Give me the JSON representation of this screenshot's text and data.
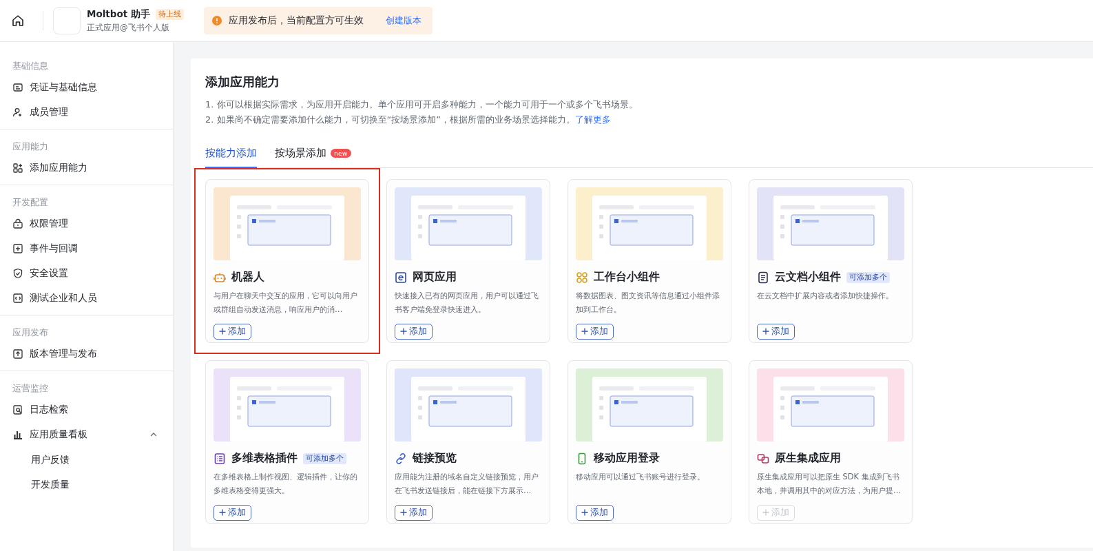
{
  "topbar": {
    "app_name": "Moltbot 助手",
    "status_badge": "待上线",
    "app_subtitle": "正式应用@飞书个人版",
    "notice": {
      "text": "应用发布后，当前配置方可生效",
      "link": "创建版本"
    }
  },
  "sidebar": {
    "sections": [
      {
        "title": "基础信息",
        "items": [
          {
            "label": "凭证与基础信息"
          },
          {
            "label": "成员管理"
          }
        ]
      },
      {
        "title": "应用能力",
        "items": [
          {
            "label": "添加应用能力"
          }
        ]
      },
      {
        "title": "开发配置",
        "items": [
          {
            "label": "权限管理"
          },
          {
            "label": "事件与回调"
          },
          {
            "label": "安全设置"
          },
          {
            "label": "测试企业和人员"
          }
        ]
      },
      {
        "title": "应用发布",
        "items": [
          {
            "label": "版本管理与发布"
          }
        ]
      },
      {
        "title": "运营监控",
        "items": [
          {
            "label": "日志检索"
          },
          {
            "label": "应用质量看板",
            "expanded": true,
            "children": [
              {
                "label": "用户反馈"
              },
              {
                "label": "开发质量"
              }
            ]
          }
        ]
      }
    ]
  },
  "main": {
    "title": "添加应用能力",
    "notes": [
      "1. 你可以根据实际需求，为应用开启能力。单个应用可开启多种能力，一个能力可用于一个或多个飞书场景。",
      "2. 如果尚不确定需要添加什么能力，可切换至“按场景添加”，根据所需的业务场景选择能力。"
    ],
    "learn_more": "了解更多",
    "tabs": [
      {
        "label": "按能力添加",
        "selected": true
      },
      {
        "label": "按场景添加",
        "selected": false,
        "badge": "new"
      }
    ],
    "cards": [
      {
        "kind": "robot",
        "title": "机器人",
        "description": "与用户在聊天中交互的应用，它可以向用户或群组自动发送消息，响应用户的消…",
        "button": "添加",
        "disabled": false,
        "highlighted": true,
        "color": "#fbe6cf"
      },
      {
        "kind": "web",
        "title": "网页应用",
        "description": "快速接入已有的网页应用，用户可以通过飞书客户端免登录快速进入。",
        "button": "添加",
        "disabled": false,
        "highlighted": false,
        "color": "#e1e7fb"
      },
      {
        "kind": "widget",
        "title": "工作台小组件",
        "description": "将数据图表、图文资讯等信息通过小组件添加到工作台。",
        "button": "添加",
        "disabled": false,
        "highlighted": false,
        "color": "#fbefcc"
      },
      {
        "kind": "doc",
        "title": "云文档小组件",
        "badge": "可添加多个",
        "description": "在云文档中扩展内容或者添加快捷操作。",
        "button": "添加",
        "disabled": false,
        "highlighted": false,
        "color": "#e3e3f7"
      },
      {
        "kind": "table",
        "title": "多维表格插件",
        "badge": "可添加多个",
        "description": "在多维表格上制作视图、逻辑插件，让你的多维表格变得更强大。",
        "button": "添加",
        "disabled": false,
        "highlighted": false,
        "color": "#ebe2fa"
      },
      {
        "kind": "link",
        "title": "链接预览",
        "description": "应用能为注册的域名自定义链接预览，用户在飞书发送链接后，能在链接下方展示…",
        "button": "添加",
        "disabled": false,
        "highlighted": false,
        "color": "#dfe6fb"
      },
      {
        "kind": "phone",
        "title": "移动应用登录",
        "description": "移动应用可以通过飞书账号进行登录。",
        "button": "添加",
        "disabled": false,
        "highlighted": false,
        "color": "#dcf0d7"
      },
      {
        "kind": "native",
        "title": "原生集成应用",
        "description": "原生集成应用可以把原生 SDK 集成到飞书本地，并调用其中的对应方法，为用户提…",
        "button": "添加",
        "disabled": true,
        "highlighted": false,
        "color": "#fbdfe9"
      }
    ]
  }
}
